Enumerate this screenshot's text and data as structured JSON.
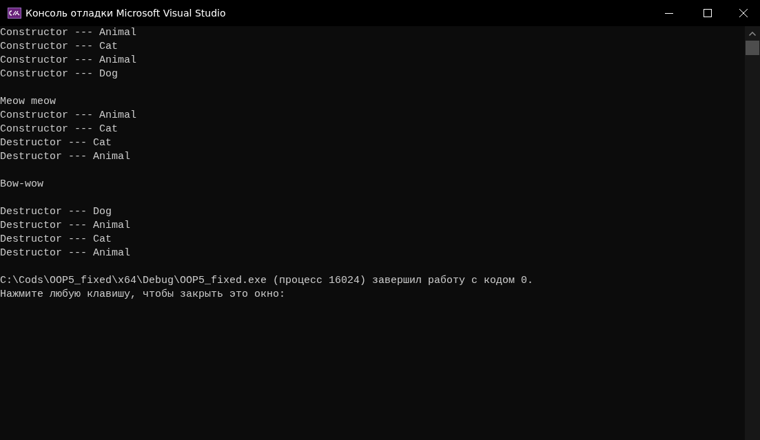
{
  "window": {
    "title": "Консоль отладки Microsoft Visual Studio"
  },
  "console": {
    "blocks": [
      [
        "Constructor --- Animal",
        "Constructor --- Cat",
        "Constructor --- Animal",
        "Constructor --- Dog"
      ],
      [
        "Meow meow",
        "Constructor --- Animal",
        "Constructor --- Cat",
        "Destructor --- Cat",
        "Destructor --- Animal"
      ],
      [
        "Bow-wow"
      ],
      [
        "Destructor --- Dog",
        "Destructor --- Animal",
        "Destructor --- Cat",
        "Destructor --- Animal"
      ],
      [
        "C:\\Cods\\OOP5_fixed\\x64\\Debug\\OOP5_fixed.exe (процесс 16024) завершил работу с кодом 0.",
        "Нажмите любую клавишу, чтобы закрыть это окно:"
      ]
    ]
  }
}
